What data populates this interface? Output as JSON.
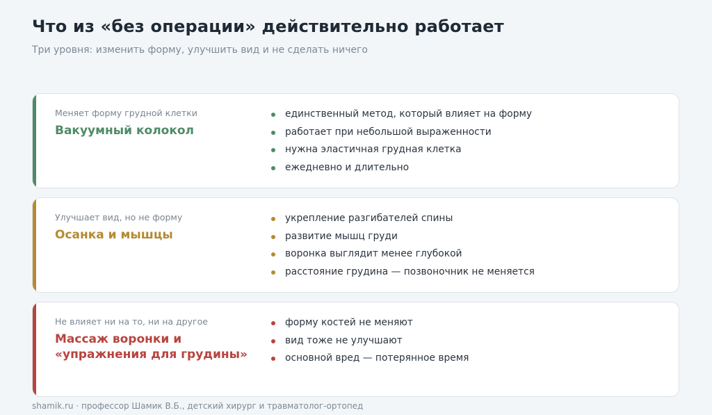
{
  "header": {
    "title": "Что из «без операции» действительно работает",
    "subtitle": "Три уровня: изменить форму, улучшить вид и не сделать ничего"
  },
  "cards": [
    {
      "kicker": "Меняет форму грудной клетки",
      "heading_lines": [
        "Вакуумный колокол"
      ],
      "color": "#4f8a68",
      "points": [
        "единственный метод, который влияет на форму",
        "работает при небольшой выраженности",
        "нужна эластичная грудная клетка",
        "ежедневно и длительно"
      ]
    },
    {
      "kicker": "Улучшает вид, но не форму",
      "heading_lines": [
        "Осанка и мышцы"
      ],
      "color": "#b58a32",
      "points": [
        "укрепление разгибателей спины",
        "развитие мышц груди",
        "воронка выглядит менее глубокой",
        "расстояние грудина — позвоночник не меняется"
      ]
    },
    {
      "kicker": "Не влияет ни на то, ни на другое",
      "heading_lines": [
        "Массаж воронки и",
        "«упражнения для грудины»"
      ],
      "color": "#b8433f",
      "points": [
        "форму костей не меняют",
        "вид тоже не улучшают",
        "основной вред — потерянное время"
      ]
    }
  ],
  "footer": {
    "text": "shamik.ru · профессор Шамик В.Б., детский хирург и травматолог-ортопед"
  }
}
